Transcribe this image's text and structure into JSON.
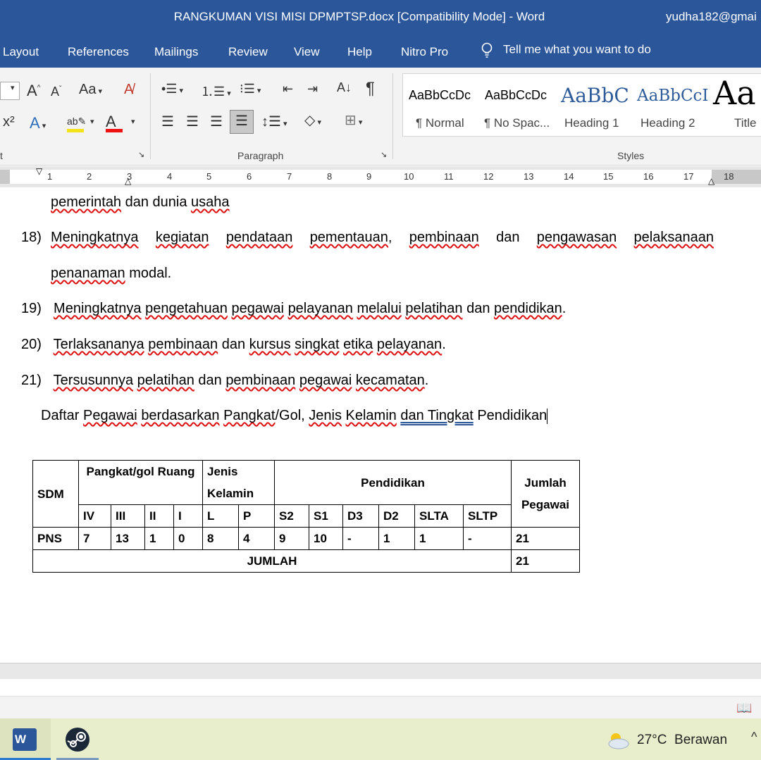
{
  "window": {
    "title": "RANGKUMAN VISI MISI DPMPTSP.docx [Compatibility Mode]  -  Word",
    "user": "yudha182@gmai"
  },
  "tabs": [
    "Layout",
    "References",
    "Mailings",
    "Review",
    "View",
    "Help",
    "Nitro Pro"
  ],
  "tell_me": "Tell me what you want to do",
  "ribbon": {
    "font_grow": "A",
    "font_shrink": "A",
    "change_case": "Aa",
    "superscript": "x²",
    "group_font": "t",
    "group_paragraph": "Paragraph",
    "group_styles": "Styles",
    "styles": [
      {
        "preview": "AaBbCcDc",
        "name": "¶ Normal"
      },
      {
        "preview": "AaBbCcDc",
        "name": "¶ No Spac..."
      },
      {
        "preview": "AaBbC",
        "name": "Heading 1"
      },
      {
        "preview": "AaBbCcI",
        "name": "Heading 2"
      },
      {
        "preview": "Aa",
        "name": "Title"
      }
    ]
  },
  "ruler": [
    "1",
    "2",
    "3",
    "4",
    "5",
    "6",
    "7",
    "8",
    "9",
    "10",
    "11",
    "12",
    "13",
    "14",
    "15",
    "16",
    "17",
    "18"
  ],
  "document": {
    "line_17_cont": {
      "w1": "pemerintah",
      "w2": " dan dunia ",
      "w3": "usaha"
    },
    "item18": {
      "num": "18)",
      "w1": "Meningkatnya",
      "w2": "kegiatan",
      "w3": "pendataan",
      "w4": "pementauan",
      "w5": "pembinaan",
      "w6": "dan",
      "w7": "pengawasan",
      "w8": "pelaksanaan",
      "cont1": "penanaman",
      "cont2": " modal."
    },
    "item19": {
      "num": "19)",
      "w1": "Meningkatnya",
      "w2": "pengetahuan",
      "w3": "pegawai",
      "w4": "pelayanan",
      "w5": "melalui",
      "w6": "pelatihan",
      "w7": "dan",
      "w8": "pendidikan",
      "end": "."
    },
    "item20": {
      "num": "20)",
      "w1": "Terlaksananya",
      "w2": "pembinaan",
      "w3": " dan ",
      "w4": "kursus",
      "w5": "singkat",
      "w6": "etika",
      "w7": "pelayanan",
      "end": "."
    },
    "item21": {
      "num": "21)",
      "w1": "Tersusunnya",
      "w2": "pelatihan",
      "w3": " dan ",
      "w4": "pembinaan",
      "w5": "pegawai",
      "w6": "kecamatan",
      "end": "."
    },
    "caption": {
      "p1": "Daftar ",
      "p2": "Pegawai",
      "p3": " ",
      "p4": "berdasarkan",
      "p5": " ",
      "p6": "Pangkat",
      "p7": "/Gol, ",
      "p8": "Jenis",
      "p9": " ",
      "p10": "Kelamin",
      "p11": " ",
      "p12": "dan  Tingkat",
      "p13": " Pendidikan"
    }
  },
  "table": {
    "h_sdm": "SDM",
    "h_pangkat": "Pangkat/gol Ruang",
    "h_jenis": "Jenis Kelamin",
    "h_pend": "Pendidikan",
    "h_jumlah": "Jumlah Pegawai",
    "sub": [
      "IV",
      "III",
      "II",
      "I",
      "L",
      "P",
      "S2",
      "S1",
      "D3",
      "D2",
      "SLTA",
      "SLTP"
    ],
    "row_label": "PNS",
    "row": [
      "7",
      "13",
      "1",
      "0",
      "8",
      "4",
      "9",
      "10",
      "-",
      "1",
      "1",
      "-"
    ],
    "row_total": "21",
    "total_label": "JUMLAH",
    "total_value": "21"
  },
  "taskbar": {
    "temp": "27°C",
    "weather": "Berawan",
    "word_label": "W"
  }
}
